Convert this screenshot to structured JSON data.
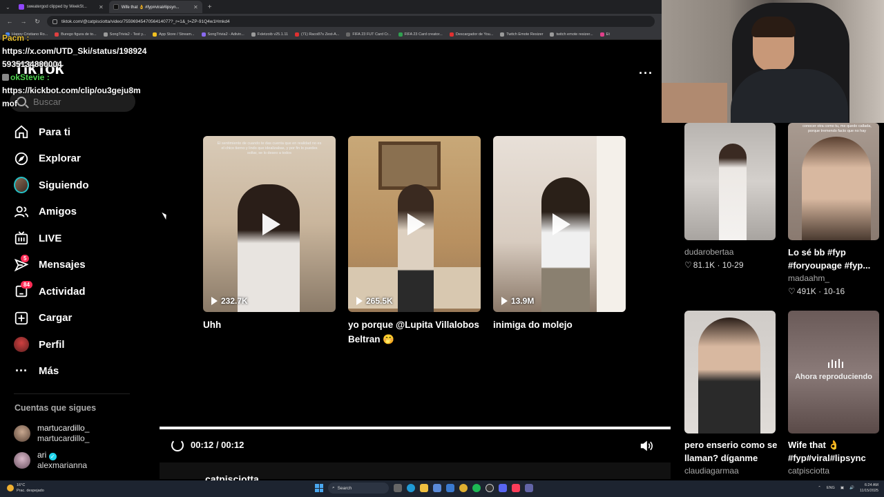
{
  "browser": {
    "tabs": [
      {
        "label": "sweatergod clipped by WeekSt..."
      },
      {
        "label": "Wife that 👌 #fyp#viral#lipsyn..."
      }
    ],
    "url": "tiktok.com/@catpisciotta/video/7559694547056414077?_r=1&_t=ZP-91Q4w1Hmkd4",
    "bookmarks": [
      {
        "label": "Happy Cristiano Ro...",
        "color": "#4a8af4"
      },
      {
        "label": "Burego figura de to...",
        "color": "#e04040"
      },
      {
        "label": "SongTrivia2 - Test y...",
        "color": "#9a9a9a"
      },
      {
        "label": "App Store / Stream...",
        "color": "#f0c020"
      },
      {
        "label": "SongTrivia2 - Adivin...",
        "color": "#8a6af0"
      },
      {
        "label": "Fxletzoib v25.1.11",
        "color": "#9a9a9a"
      },
      {
        "label": "(71) Raco87s Zest-A...",
        "color": "#e03030"
      },
      {
        "label": "FIFA 23 FUT Card Cr...",
        "color": "#6a6a6a"
      },
      {
        "label": "FIFA 23 Card creator...",
        "color": "#30a050"
      },
      {
        "label": "Descargador de You...",
        "color": "#e03030"
      },
      {
        "label": "Twitch Emote Resizer",
        "color": "#9a9a9a"
      },
      {
        "label": "twitch emote resizer...",
        "color": "#9a9a9a"
      },
      {
        "label": "Et",
        "color": "#e0408a"
      }
    ]
  },
  "chat": {
    "user1": "Pacm :",
    "msg1": "https://x.com/UTD_Ski/status/1989245935134880004",
    "user2": "okStevie :",
    "msg2": "https://kickbot.com/clip/ou3geju8mmof"
  },
  "sidebar": {
    "logo": "TikTok",
    "search_placeholder": "Buscar",
    "items": [
      {
        "label": "Para ti",
        "icon": "home-icon"
      },
      {
        "label": "Explorar",
        "icon": "compass-icon"
      },
      {
        "label": "Siguiendo",
        "icon": "following-avatar-icon"
      },
      {
        "label": "Amigos",
        "icon": "friends-icon"
      },
      {
        "label": "LIVE",
        "icon": "live-tv-icon"
      },
      {
        "label": "Mensajes",
        "icon": "send-icon",
        "badge": "5"
      },
      {
        "label": "Actividad",
        "icon": "inbox-icon",
        "badge": "84"
      },
      {
        "label": "Cargar",
        "icon": "upload-icon"
      },
      {
        "label": "Perfil",
        "icon": "profile-avatar-icon"
      },
      {
        "label": "Más",
        "icon": "more-icon"
      }
    ],
    "following_title": "Cuentas que sigues",
    "accounts": [
      {
        "display": "martucardillo_",
        "handle": "martucardillo_"
      },
      {
        "display": "ari",
        "handle": "alexmarianna",
        "verified": true
      }
    ]
  },
  "player": {
    "cards": [
      {
        "views": "232.7K",
        "title": "Uhh",
        "caption": "El sentimiento de cuando te das cuenta que en realidad no es el chico tierno y lindo que idealizabas, y por fin lo puedes soltar, se lo deseo a todos"
      },
      {
        "views": "265.5K",
        "title": "yo porque @Lupita Villalobos Beltran 🤭"
      },
      {
        "views": "13.9M",
        "title": "inimiga do molejo"
      }
    ],
    "progress": 1.0,
    "time": "00:12 / 00:12",
    "author": "catpisciotta"
  },
  "recommendations": [
    {
      "title": "",
      "author": "dudarobertaa",
      "likes": "81.1K",
      "date": "10-29"
    },
    {
      "title": "Lo sé bb #fyp #foryoupage #fyp...",
      "author": "madaahm_",
      "likes": "491K",
      "date": "10-16",
      "overlay": "conocer otra como tu, me quedo callada, porque tremendo facto que no hay"
    },
    {
      "title": "pero enserio como se llaman? díganme",
      "author": "claudiagarmaa"
    },
    {
      "title": "Wife that 👌 #fyp#viral#lipsync",
      "author": "catpisciotta",
      "status": "Ahora reproduciendo"
    }
  ],
  "taskbar": {
    "temp": "16°C",
    "weather": "Prac. despejado",
    "search": "Search",
    "lang": "ENG",
    "time": "6:24 AM",
    "date": "11/15/2025"
  }
}
